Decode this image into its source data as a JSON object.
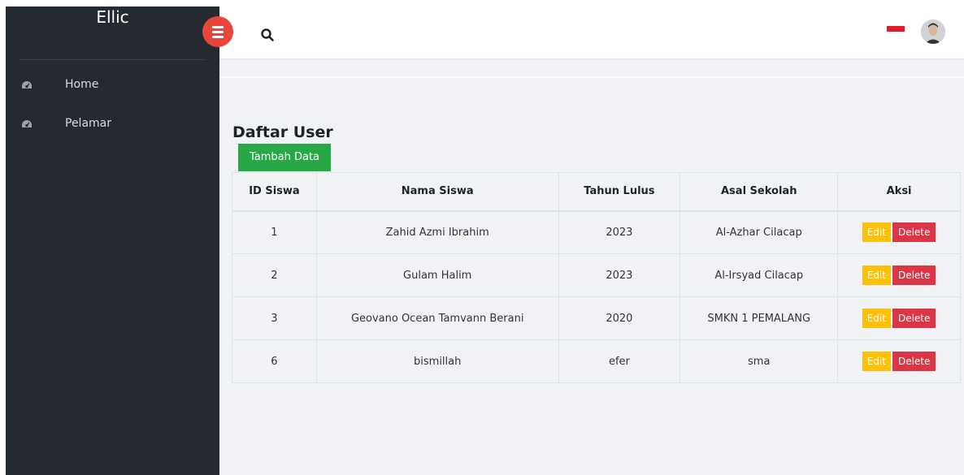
{
  "sidebar": {
    "brand": "Ellic",
    "items": [
      {
        "label": "Home",
        "icon": "dashboard-icon"
      },
      {
        "label": "Pelamar",
        "icon": "dashboard-icon"
      }
    ]
  },
  "topbar": {
    "search_icon": "search-icon",
    "language_flag": "indonesia-flag",
    "avatar": "user-avatar"
  },
  "page": {
    "title": "Daftar User",
    "add_button": "Tambah Data"
  },
  "table": {
    "headers": [
      "ID Siswa",
      "Nama Siswa",
      "Tahun Lulus",
      "Asal Sekolah",
      "Aksi"
    ],
    "rows": [
      {
        "id": "1",
        "nama": "Zahid Azmi Ibrahim",
        "tahun": "2023",
        "asal": "Al-Azhar Cilacap"
      },
      {
        "id": "2",
        "nama": "Gulam Halim",
        "tahun": "2023",
        "asal": "Al-Irsyad Cilacap"
      },
      {
        "id": "3",
        "nama": "Geovano Ocean Tamvann Berani",
        "tahun": "2020",
        "asal": "SMKN 1 PEMALANG"
      },
      {
        "id": "6",
        "nama": "bismillah",
        "tahun": "efer",
        "asal": "sma"
      }
    ],
    "edit_label": "Edit",
    "delete_label": "Delete"
  },
  "colors": {
    "sidebar": "#252a30",
    "toggle": "#e8453c",
    "add_button": "#27a745",
    "edit_button": "#ffc107",
    "delete_button": "#dc3545"
  }
}
